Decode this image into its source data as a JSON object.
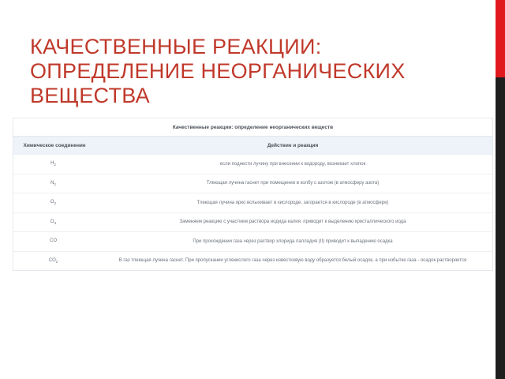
{
  "slide": {
    "title": "КАЧЕСТВЕННЫЕ РЕАКЦИИ: ОПРЕДЕЛЕНИЕ НЕОРГАНИЧЕСКИХ ВЕЩЕСТВА"
  },
  "table": {
    "caption": "Качественные реакции: определение неорганических веществ",
    "headers": {
      "compound": "Химическое соединение",
      "action": "Действие и реакция"
    },
    "rows": [
      {
        "formula": "H",
        "sub": "2",
        "action": "если поднести лучину при внесении к водороду, возникает хлопок"
      },
      {
        "formula": "N",
        "sub": "2",
        "action": "Тлеющая лучина гаснет при помещении в колбу с азотом (в атмосферу азота)"
      },
      {
        "formula": "O",
        "sub": "2",
        "action": "Тлеющая лучина ярко вспыхивает в кислороде, загорается в кислороде (в атмосфере)"
      },
      {
        "formula": "O",
        "sub": "3",
        "action": "Заменяем реакцию с участием раствора иодида калия: приводит к выделению кристаллического иода"
      },
      {
        "formula": "CO",
        "sub": "",
        "action": "При прохождении газа через раствор хлорида палладия (II) приводит к выпадению осадка"
      },
      {
        "formula": "CO",
        "sub": "2",
        "action": "В газ тлеющая лучина гаснет. При пропускании углекислого газа через известковую воду образуется белый осадок, а при избытке газа - осадок растворяется"
      }
    ]
  }
}
